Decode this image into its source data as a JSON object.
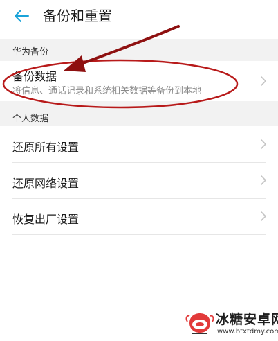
{
  "header": {
    "title": "备份和重置",
    "back_icon": "arrow-left-icon"
  },
  "sections": [
    {
      "label": "华为备份",
      "items": [
        {
          "title": "备份数据",
          "subtitle": "将信息、通话记录和系统相关数据等备份到本地"
        }
      ]
    },
    {
      "label": "个人数据",
      "items": [
        {
          "title": "还原所有设置"
        },
        {
          "title": "还原网络设置"
        },
        {
          "title": "恢复出厂设置"
        }
      ]
    }
  ],
  "watermark": {
    "name": "冰糖安卓网",
    "url": "www.btxtdmy.com"
  },
  "colors": {
    "accent": "#1aa3d9",
    "annotation": "#b81a1a",
    "section_bg": "#f2f2f2"
  }
}
